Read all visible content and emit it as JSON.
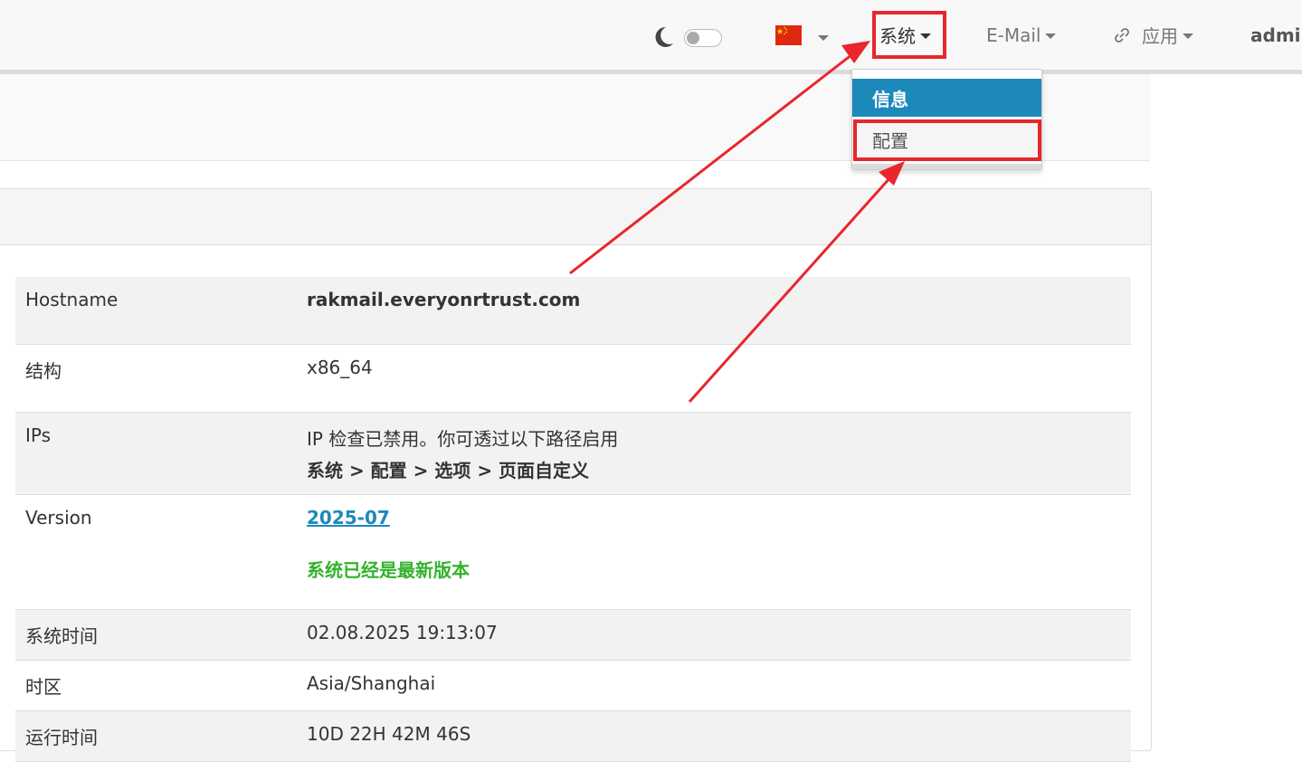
{
  "navbar": {
    "system_label": "系统",
    "email_label": "E-Mail",
    "apps_label": "应用",
    "user_label": "admin"
  },
  "dropdown": {
    "items": [
      {
        "label": "信息"
      },
      {
        "label": "配置"
      }
    ]
  },
  "info_table": [
    {
      "key": "Hostname",
      "value": "rakmail.everyonrtrust.com"
    },
    {
      "key": "结构",
      "value": "x86_64"
    },
    {
      "key": "IPs",
      "value": "IP 检查已禁用。你可透过以下路径启用",
      "path": "系统 > 配置 > 选项 > 页面自定义"
    },
    {
      "key": "Version",
      "value": "2025-07",
      "status": "系统已经是最新版本"
    },
    {
      "key": "系统时间",
      "value": "02.08.2025 19:13:07"
    },
    {
      "key": "时区",
      "value": "Asia/Shanghai"
    },
    {
      "key": "运行时间",
      "value": "10D 22H 42M 46S"
    }
  ],
  "colors": {
    "accent": "#1d89ba",
    "success": "#33b32c",
    "annotation": "#e8262b"
  }
}
